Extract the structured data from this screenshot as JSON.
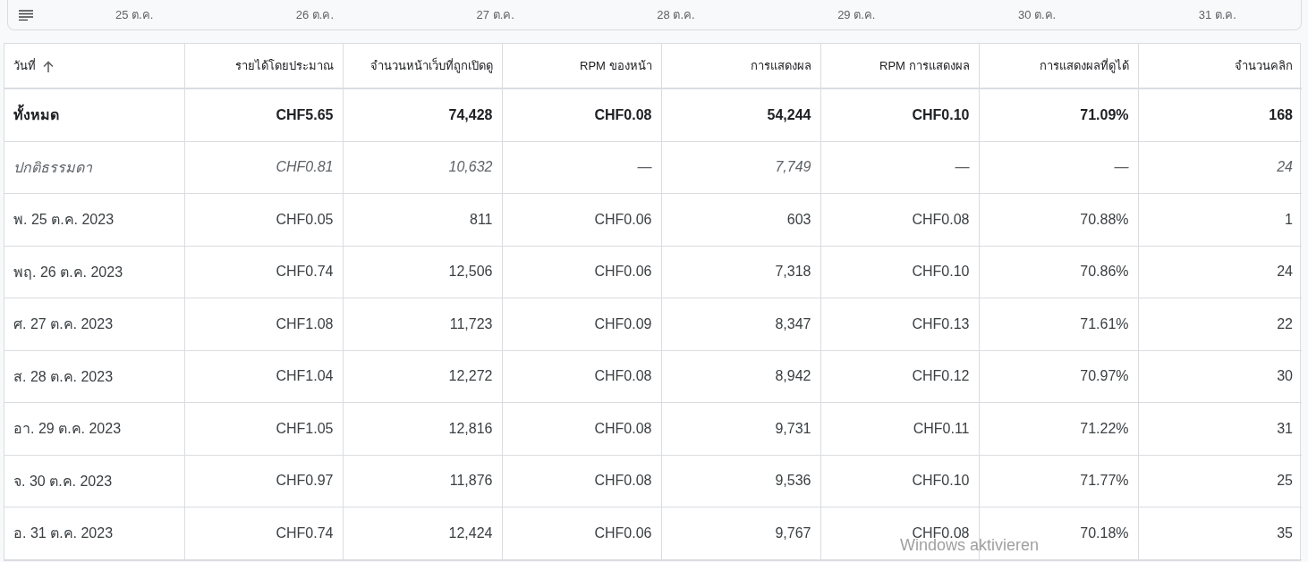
{
  "timeline": {
    "dates": [
      "25 ต.ค.",
      "26 ต.ค.",
      "27 ต.ค.",
      "28 ต.ค.",
      "29 ต.ค.",
      "30 ต.ค.",
      "31 ต.ค."
    ]
  },
  "table": {
    "columns": [
      {
        "label": "วันที่",
        "sorted": true
      },
      {
        "label": "รายได้โดยประมาณ",
        "sorted": false
      },
      {
        "label": "จำนวนหน้าเว็บที่ถูกเปิดดู",
        "sorted": false
      },
      {
        "label": "RPM ของหน้า",
        "sorted": false
      },
      {
        "label": "การแสดงผล",
        "sorted": false
      },
      {
        "label": "RPM การแสดงผล",
        "sorted": false
      },
      {
        "label": "การแสดงผลที่ดูได้",
        "sorted": false
      },
      {
        "label": "จำนวนคลิก",
        "sorted": false
      }
    ],
    "rows": [
      {
        "kind": "total",
        "cells": [
          "ทั้งหมด",
          "CHF5.65",
          "74,428",
          "CHF0.08",
          "54,244",
          "CHF0.10",
          "71.09%",
          "168"
        ]
      },
      {
        "kind": "average",
        "cells": [
          "ปกติธรรมดา",
          "CHF0.81",
          "10,632",
          "—",
          "7,749",
          "—",
          "—",
          "24"
        ]
      },
      {
        "kind": "day",
        "cells": [
          "พ. 25 ต.ค. 2023",
          "CHF0.05",
          "811",
          "CHF0.06",
          "603",
          "CHF0.08",
          "70.88%",
          "1"
        ]
      },
      {
        "kind": "day",
        "cells": [
          "พฤ. 26 ต.ค. 2023",
          "CHF0.74",
          "12,506",
          "CHF0.06",
          "7,318",
          "CHF0.10",
          "70.86%",
          "24"
        ]
      },
      {
        "kind": "day",
        "cells": [
          "ศ. 27 ต.ค. 2023",
          "CHF1.08",
          "11,723",
          "CHF0.09",
          "8,347",
          "CHF0.13",
          "71.61%",
          "22"
        ]
      },
      {
        "kind": "day",
        "cells": [
          "ส. 28 ต.ค. 2023",
          "CHF1.04",
          "12,272",
          "CHF0.08",
          "8,942",
          "CHF0.12",
          "70.97%",
          "30"
        ]
      },
      {
        "kind": "day",
        "cells": [
          "อา. 29 ต.ค. 2023",
          "CHF1.05",
          "12,816",
          "CHF0.08",
          "9,731",
          "CHF0.11",
          "71.22%",
          "31"
        ]
      },
      {
        "kind": "day",
        "cells": [
          "จ. 30 ต.ค. 2023",
          "CHF0.97",
          "11,876",
          "CHF0.08",
          "9,536",
          "CHF0.10",
          "71.77%",
          "25"
        ]
      },
      {
        "kind": "day",
        "cells": [
          "อ. 31 ต.ค. 2023",
          "CHF0.74",
          "12,424",
          "CHF0.06",
          "9,767",
          "CHF0.08",
          "70.18%",
          "35"
        ]
      }
    ]
  },
  "os_notice": "Windows aktivieren"
}
